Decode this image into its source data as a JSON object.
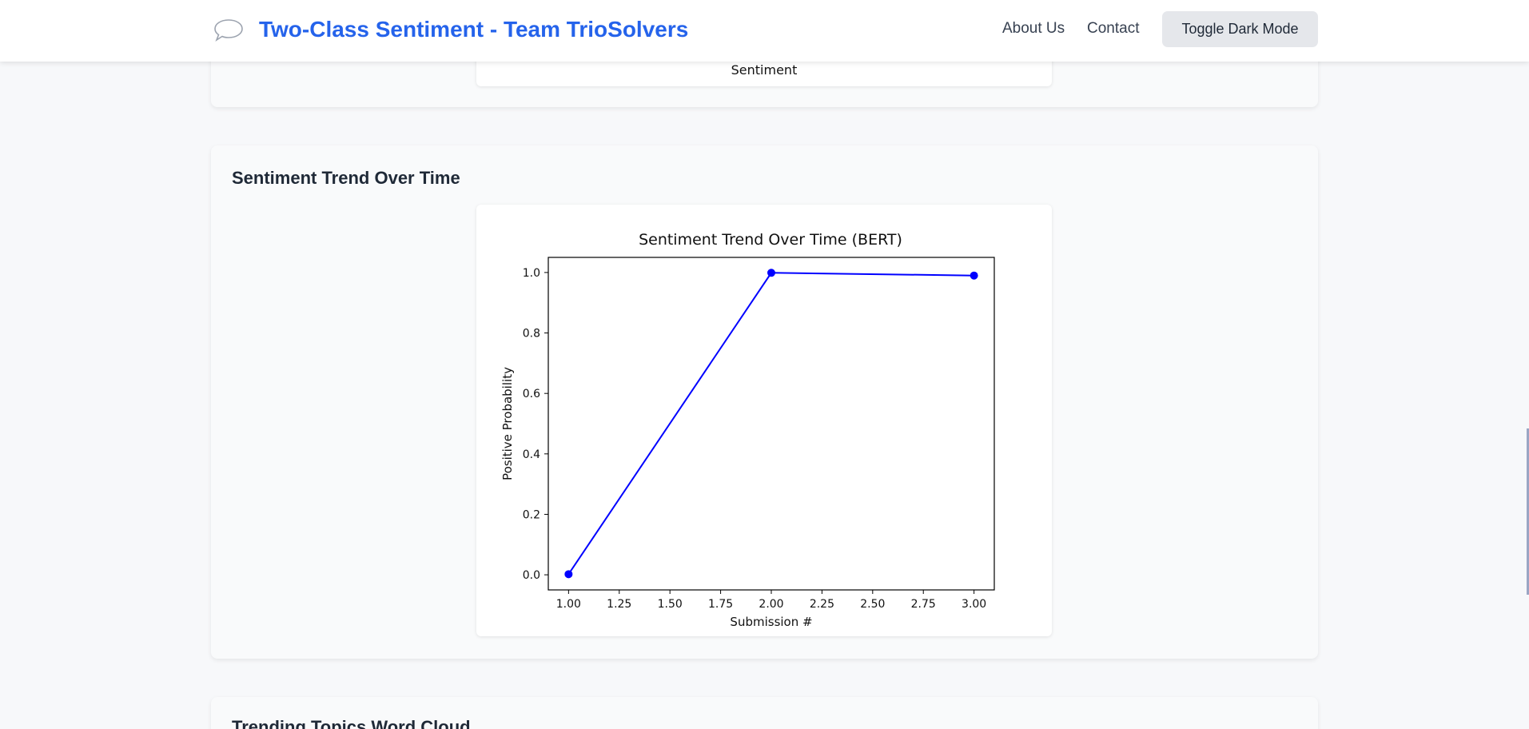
{
  "navbar": {
    "icon": "speech-bubble-icon",
    "title": "Two-Class Sentiment - Team TrioSolvers",
    "links": [
      "About Us",
      "Contact"
    ],
    "toggle_label": "Toggle Dark Mode"
  },
  "previous_section": {
    "chart_xlabel": "Sentiment"
  },
  "trend_section": {
    "title": "Sentiment Trend Over Time"
  },
  "next_section": {
    "title": "Trending Topics Word Cloud"
  },
  "colors": {
    "accent": "#2563eb",
    "line": "#0000ff"
  },
  "chart_data": {
    "type": "line",
    "title": "Sentiment Trend Over Time (BERT)",
    "xlabel": "Submission #",
    "ylabel": "Positive Probability",
    "x": [
      1,
      2,
      3
    ],
    "series": [
      {
        "values": [
          0.002,
          0.999,
          0.99
        ]
      }
    ],
    "xlim": [
      0.9,
      3.1
    ],
    "ylim": [
      -0.05,
      1.05
    ],
    "xticks": [
      "1.00",
      "1.25",
      "1.50",
      "1.75",
      "2.00",
      "2.25",
      "2.50",
      "2.75",
      "3.00"
    ],
    "yticks": [
      "0.0",
      "0.2",
      "0.4",
      "0.6",
      "0.8",
      "1.0"
    ],
    "markers": true,
    "grid": false
  }
}
